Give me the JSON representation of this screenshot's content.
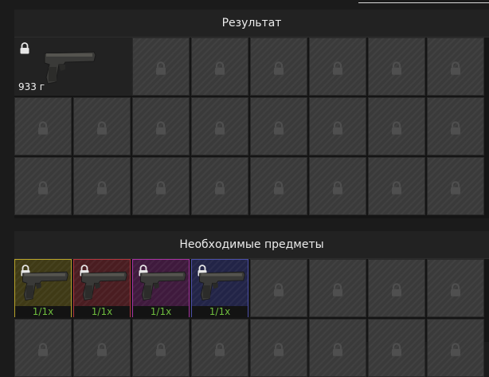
{
  "result_panel": {
    "title": "Результат",
    "item": {
      "weight": "933 г",
      "icon": "pistol-icon",
      "locked": true
    }
  },
  "required_panel": {
    "title": "Необходимые предметы",
    "items": [
      {
        "quantity": "1/1x",
        "rarity_color": "#b8a42a",
        "bg_color": "#3f3a16",
        "icon": "pistol-icon"
      },
      {
        "quantity": "1/1x",
        "rarity_color": "#b2363e",
        "bg_color": "#4a1d21",
        "icon": "pistol-icon"
      },
      {
        "quantity": "1/1x",
        "rarity_color": "#a632a0",
        "bg_color": "#3f1a3d",
        "icon": "pistol-icon"
      },
      {
        "quantity": "1/1x",
        "rarity_color": "#4b4fa8",
        "bg_color": "#222447",
        "icon": "pistol-icon"
      }
    ]
  },
  "colors": {
    "background": "#1b1b1b",
    "slot": "#3a3a3a",
    "quantity_text": "#6fbe3e"
  }
}
